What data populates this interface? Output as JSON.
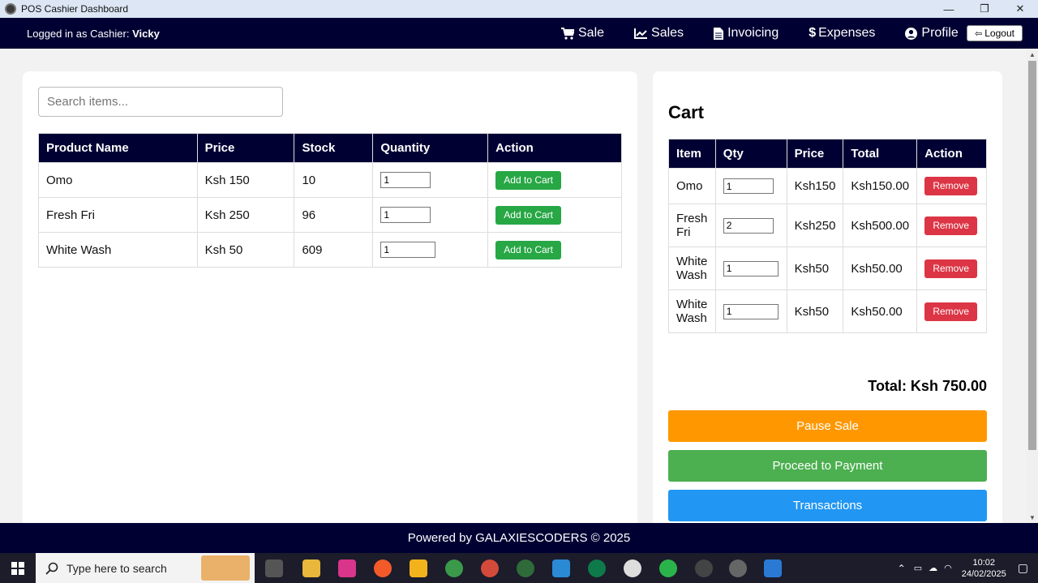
{
  "window": {
    "title": "POS Cashier Dashboard",
    "controls": [
      "—",
      "❐",
      "✕"
    ]
  },
  "nav": {
    "logged_prefix": "Logged in as Cashier: ",
    "user": "Vicky",
    "links": [
      {
        "label": "Sale",
        "icon": "cart-icon"
      },
      {
        "label": "Sales",
        "icon": "chart-icon"
      },
      {
        "label": "Invoicing",
        "icon": "document-icon"
      },
      {
        "label": "Expenses",
        "icon": "dollar-icon"
      },
      {
        "label": "Profile",
        "icon": "user-circle-icon"
      }
    ],
    "logout_label": "Logout"
  },
  "search": {
    "placeholder": "Search items..."
  },
  "products": {
    "headers": [
      "Product Name",
      "Price",
      "Stock",
      "Quantity",
      "Action"
    ],
    "rows": [
      {
        "name": "Omo",
        "price": "Ksh 150",
        "stock": "10",
        "qty": "1",
        "action": "Add to Cart"
      },
      {
        "name": "Fresh Fri",
        "price": "Ksh 250",
        "stock": "96",
        "qty": "1",
        "action": "Add to Cart"
      },
      {
        "name": "White Wash",
        "price": "Ksh 50",
        "stock": "609",
        "qty": "1",
        "action": "Add to Cart"
      }
    ]
  },
  "cart": {
    "title": "Cart",
    "headers": [
      "Item",
      "Qty",
      "Price",
      "Total",
      "Action"
    ],
    "rows": [
      {
        "item": "Omo",
        "qty": "1",
        "price": "Ksh150",
        "total": "Ksh150.00",
        "action": "Remove"
      },
      {
        "item": "Fresh Fri",
        "qty": "2",
        "price": "Ksh250",
        "total": "Ksh500.00",
        "action": "Remove"
      },
      {
        "item": "White Wash",
        "qty": "1",
        "price": "Ksh50",
        "total": "Ksh50.00",
        "action": "Remove"
      },
      {
        "item": "White Wash",
        "qty": "1",
        "price": "Ksh50",
        "total": "Ksh50.00",
        "action": "Remove"
      }
    ],
    "total": "Total: Ksh 750.00",
    "pause_label": "Pause Sale",
    "proceed_label": "Proceed to Payment",
    "transactions_label": "Transactions"
  },
  "footer": {
    "text": "Powered by GALAXIESCODERS © 2025"
  },
  "taskbar": {
    "search_placeholder": "Type here to search",
    "time": "10:02",
    "date": "24/02/2025"
  },
  "colors": {
    "nav_bg": "#000033",
    "add_btn": "#28a745",
    "remove_btn": "#dc3545",
    "pause_btn": "#ff9800",
    "proceed_btn": "#4caf50",
    "transactions_btn": "#2196f3"
  }
}
